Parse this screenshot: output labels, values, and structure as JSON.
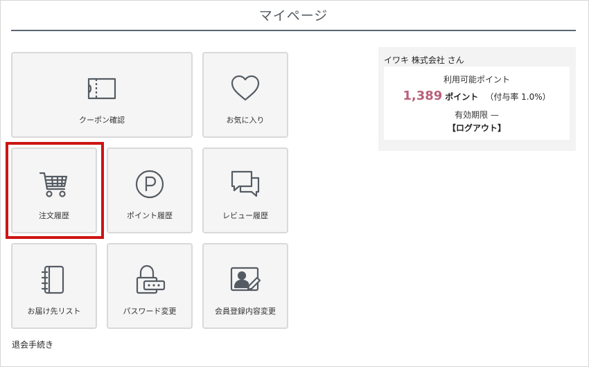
{
  "page": {
    "title": "マイページ"
  },
  "tiles": [
    {
      "label": "クーポン確認",
      "icon": "ticket-icon"
    },
    {
      "label": "お気に入り",
      "icon": "heart-icon"
    },
    {
      "label": "注文履歴",
      "icon": "cart-icon"
    },
    {
      "label": "ポイント履歴",
      "icon": "point-icon"
    },
    {
      "label": "レビュー履歴",
      "icon": "speech-bubbles-icon"
    },
    {
      "label": "お届け先リスト",
      "icon": "address-book-icon"
    },
    {
      "label": "パスワード変更",
      "icon": "lock-icon"
    },
    {
      "label": "会員登録内容変更",
      "icon": "profile-edit-icon"
    }
  ],
  "footer": {
    "withdraw_label": "退会手続き"
  },
  "points_panel": {
    "user_name": "イワキ 株式会社 さん",
    "available_label": "利用可能ポイント",
    "points_value": "1,389",
    "points_unit": "ポイント",
    "rate_text": "（付与率 1.0%）",
    "expiry_text": "有効期限 —",
    "logout_label": "【ログアウト】"
  },
  "colors": {
    "highlight": "#cc1414",
    "points_value": "#b9607a",
    "title_rule": "#5a6570",
    "tile_bg": "#f5f5f5",
    "panel_bg": "#f3f3f3"
  }
}
